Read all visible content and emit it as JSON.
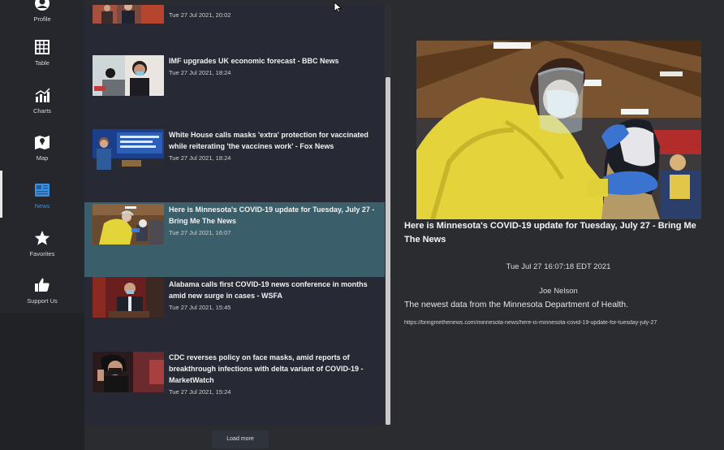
{
  "sidebar": {
    "items": [
      {
        "label": "Profile",
        "icon": "profile-icon"
      },
      {
        "label": "Table",
        "icon": "table-icon"
      },
      {
        "label": "Charts",
        "icon": "charts-icon"
      },
      {
        "label": "Map",
        "icon": "map-icon"
      },
      {
        "label": "News",
        "icon": "news-icon"
      },
      {
        "label": "Favorites",
        "icon": "star-icon"
      },
      {
        "label": "Support Us",
        "icon": "thumbs-up-icon"
      }
    ],
    "active": "News"
  },
  "news": {
    "items": [
      {
        "title": "",
        "date": "Tue 27 Jul 2021, 20:02"
      },
      {
        "title": "IMF upgrades UK economic forecast - BBC News",
        "date": "Tue 27 Jul 2021, 18:24"
      },
      {
        "title": "White House calls masks 'extra' protection for vaccinated while reiterating 'the vaccines work' - Fox News",
        "date": "Tue 27 Jul 2021, 18:24"
      },
      {
        "title": "Here is Minnesota's COVID-19 update for Tuesday, July 27 - Bring Me The News",
        "date": "Tue 27 Jul 2021, 16:07"
      },
      {
        "title": "Alabama calls first COVID-19 news conference in months amid new surge in cases - WSFA",
        "date": "Tue 27 Jul 2021, 15:45"
      },
      {
        "title": "CDC reverses policy on face masks, amid reports of breakthrough infections with delta variant of COVID-19 - MarketWatch",
        "date": "Tue 27 Jul 2021, 15:24"
      }
    ],
    "load_more": "Load more"
  },
  "detail": {
    "title": "Here is Minnesota's COVID-19 update for Tuesday, July 27 - Bring Me The News",
    "date": "Tue Jul 27 16:07:18 EDT 2021",
    "author": "Joe Nelson",
    "summary": "The newest data from the Minnesota Department of Health.",
    "url": "https://bringmethenews.com/minnesota-news/here-is-minnesota-covid-19-update-for-tuesday-july-27"
  },
  "colors": {
    "sidebar": "#202226",
    "list_bg": "#272a34",
    "selected": "#3a5f6b",
    "active_nav": "#3d8fe0"
  }
}
